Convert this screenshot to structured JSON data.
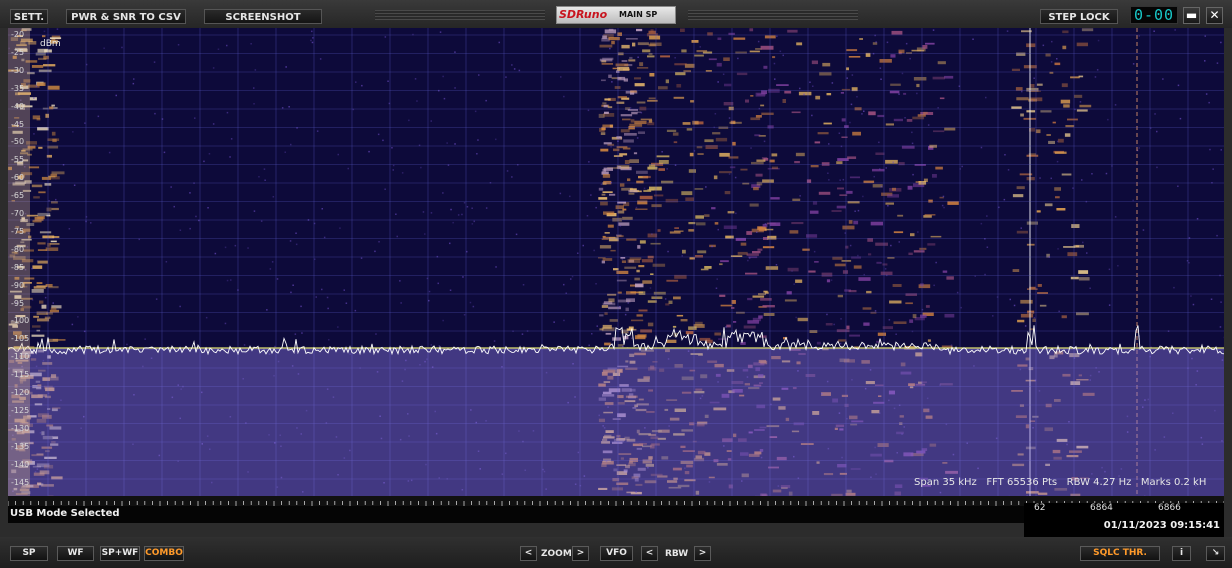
{
  "topbar": {
    "settings_label": "SETT.",
    "pwr_snr_label": "PWR & SNR TO CSV",
    "screenshot_label": "SCREENSHOT",
    "brand": "SDRuno",
    "window_mode": "MAIN SP",
    "step_lock_label": "STEP LOCK",
    "digit_display": "0-00",
    "minimize_symbol": "▬",
    "close_symbol": "✕"
  },
  "spectrum": {
    "unit": "dBm",
    "y_ticks": [
      "-20",
      "-25",
      "-30",
      "-35",
      "-40",
      "-45",
      "-50",
      "-55",
      "-60",
      "-65",
      "-70",
      "-75",
      "-80",
      "-85",
      "-90",
      "-95",
      "-100",
      "-105",
      "-110",
      "-115",
      "-120",
      "-125",
      "-130",
      "-135",
      "-140",
      "-145"
    ],
    "info": "Span 35 kHz   FFT 65536 Pts   RBW 4.27 Hz   Marks 0.2 kH",
    "freq_labels": [
      "62",
      "6864",
      "6866"
    ],
    "status": "USB Mode Selected",
    "datetime": "01/11/2023 09:15:41",
    "colors": {
      "background": "#0d0a3a",
      "trace": "#ffffff",
      "squelch_line": "#e0e070"
    }
  },
  "bottombar": {
    "sp_label": "SP",
    "wf_label": "WF",
    "spwf_label": "SP+WF",
    "combo_label": "COMBO",
    "zoom_label": "ZOOM",
    "vfo_label": "VFO",
    "rbw_label": "RBW",
    "prev_symbol": "<",
    "next_symbol": ">",
    "sqlc_label": "SQLC THR.",
    "info_label": "i",
    "resize_symbol": "↘"
  }
}
